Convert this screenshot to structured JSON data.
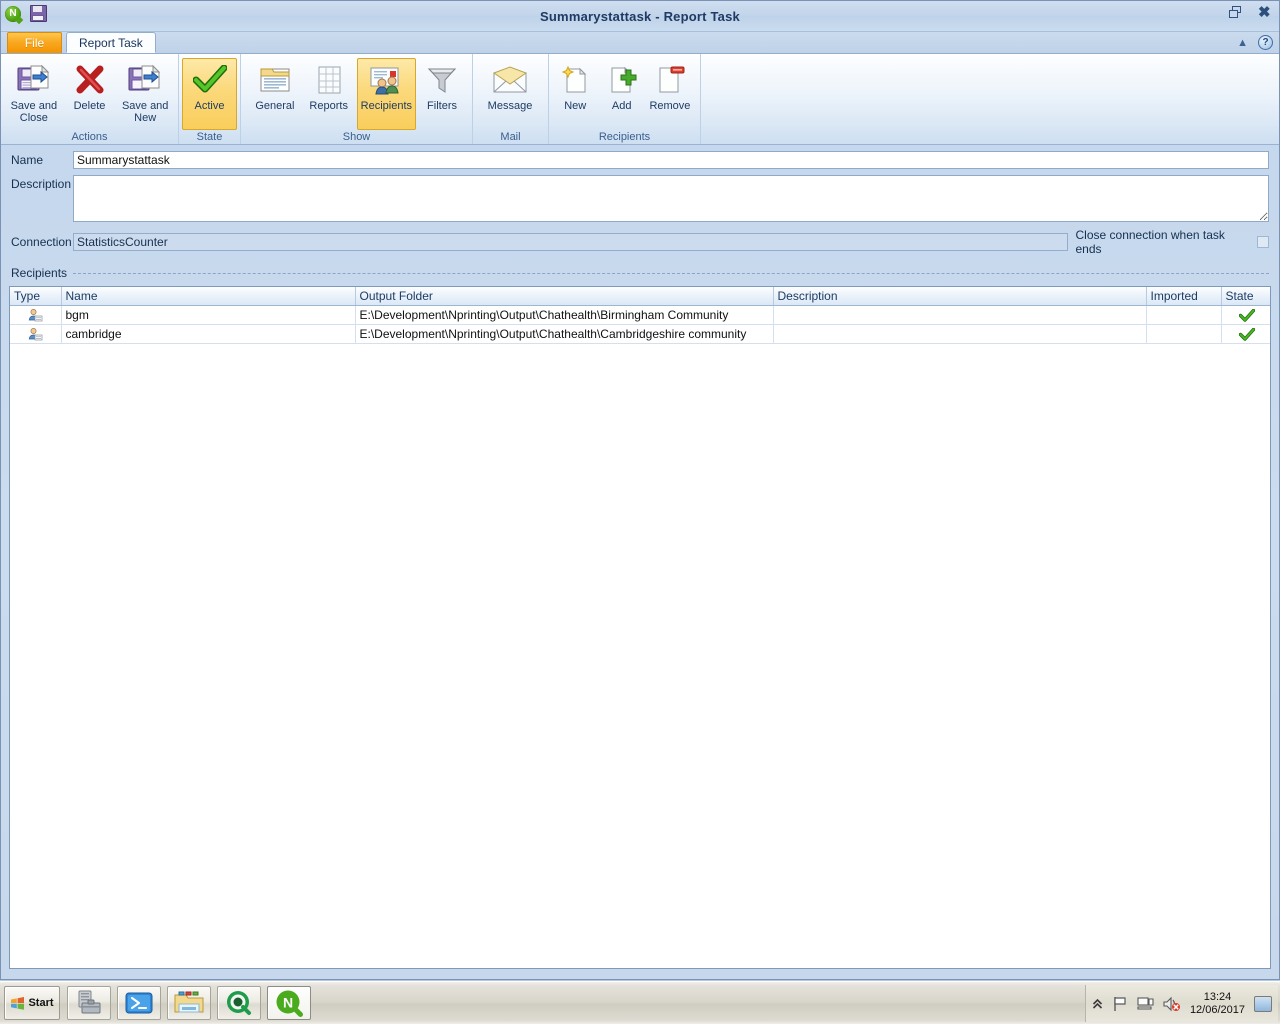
{
  "window": {
    "title": "Summarystattask - Report Task",
    "logo_icon": "nprinting-logo-icon",
    "save_icon": "save-icon",
    "restore_icon": "restore-window-icon",
    "close_icon": "close-window-icon",
    "help_icon": "help-icon",
    "collapse_ribbon_icon": "chevron-up-icon"
  },
  "tabs": {
    "file": "File",
    "report_task": "Report Task"
  },
  "ribbon": {
    "groups": [
      {
        "label": "Actions",
        "items": [
          {
            "label": "Save and Close",
            "icon": "save-and-close-icon",
            "selected": false
          },
          {
            "label": "Delete",
            "icon": "delete-x-icon",
            "selected": false
          },
          {
            "label": "Save and New",
            "icon": "save-and-new-icon",
            "selected": false
          }
        ]
      },
      {
        "label": "State",
        "items": [
          {
            "label": "Active",
            "icon": "green-check-icon",
            "selected": true
          }
        ]
      },
      {
        "label": "Show",
        "items": [
          {
            "label": "General",
            "icon": "general-list-icon",
            "selected": false
          },
          {
            "label": "Reports",
            "icon": "reports-table-icon",
            "selected": false
          },
          {
            "label": "Recipients",
            "icon": "recipients-card-icon",
            "selected": true
          },
          {
            "label": "Filters",
            "icon": "filter-funnel-icon",
            "selected": false
          }
        ]
      },
      {
        "label": "Mail",
        "items": [
          {
            "label": "Message",
            "icon": "envelope-icon",
            "selected": false
          }
        ]
      },
      {
        "label": "Recipients",
        "items": [
          {
            "label": "New",
            "icon": "new-document-icon",
            "selected": false
          },
          {
            "label": "Add",
            "icon": "add-plus-icon",
            "selected": false
          },
          {
            "label": "Remove",
            "icon": "remove-minus-icon",
            "selected": false
          }
        ]
      }
    ]
  },
  "form": {
    "name_label": "Name",
    "name_value": "Summarystattask",
    "description_label": "Description",
    "description_value": "",
    "connection_label": "Connection",
    "connection_value": "StatisticsCounter",
    "close_connection_label": "Close connection when task ends",
    "close_connection_checked": false
  },
  "recipients_section": {
    "title": "Recipients",
    "columns": [
      "Type",
      "Name",
      "Output Folder",
      "Description",
      "Imported",
      "State"
    ],
    "rows": [
      {
        "type_icon": "user-card-icon",
        "name": "bgm",
        "output_folder": "E:\\Development\\Nprinting\\Output\\Chathealth\\Birmingham Community",
        "description": "",
        "imported": "",
        "state_icon": "green-check-icon"
      },
      {
        "type_icon": "user-card-icon",
        "name": "cambridge",
        "output_folder": "E:\\Development\\Nprinting\\Output\\Chathealth\\Cambridgeshire community",
        "description": "",
        "imported": "",
        "state_icon": "green-check-icon"
      }
    ]
  },
  "taskbar": {
    "start_label": "Start",
    "buttons": [
      {
        "icon": "server-toolbox-icon",
        "active": false
      },
      {
        "icon": "powershell-icon",
        "active": false
      },
      {
        "icon": "file-explorer-icon",
        "active": false
      },
      {
        "icon": "qlikview-icon",
        "active": false
      },
      {
        "icon": "nprinting-icon",
        "active": true
      }
    ],
    "tray": {
      "show_hidden_icon": "chevron-up-icon",
      "flag_icon": "action-center-flag-icon",
      "network_icon": "network-icon",
      "volume_muted_icon": "volume-muted-icon",
      "time": "13:24",
      "date": "12/06/2017",
      "show_desktop_icon": "show-desktop-icon"
    }
  },
  "colors": {
    "accent_orange": "#f9a821",
    "selected_yellow": "#fbd87a",
    "title_blue": "#1f3b63",
    "check_green": "#3ea01e"
  }
}
